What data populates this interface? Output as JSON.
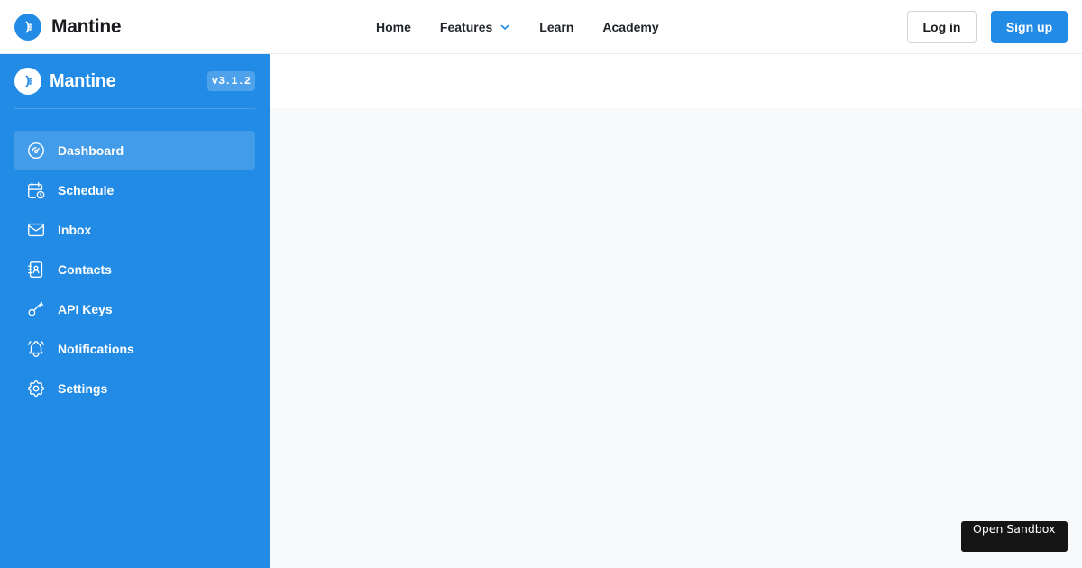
{
  "header": {
    "brand": "Mantine",
    "nav": [
      {
        "label": "Home"
      },
      {
        "label": "Features"
      },
      {
        "label": "Learn"
      },
      {
        "label": "Academy"
      }
    ],
    "login_label": "Log in",
    "signup_label": "Sign up"
  },
  "sidebar": {
    "brand": "Mantine",
    "version": "v3.1.2",
    "items": [
      {
        "label": "Dashboard",
        "icon": "gauge-icon",
        "active": true
      },
      {
        "label": "Schedule",
        "icon": "calendar-clock-icon"
      },
      {
        "label": "Inbox",
        "icon": "mail-icon"
      },
      {
        "label": "Contacts",
        "icon": "address-book-icon"
      },
      {
        "label": "API Keys",
        "icon": "key-icon"
      },
      {
        "label": "Notifications",
        "icon": "bell-ringing-icon"
      },
      {
        "label": "Settings",
        "icon": "gear-icon"
      }
    ]
  },
  "sandbox_label": "Open Sandbox",
  "colors": {
    "primary": "#228be6",
    "header_bg": "#ffffff",
    "main_bg": "#f8f9fa"
  }
}
